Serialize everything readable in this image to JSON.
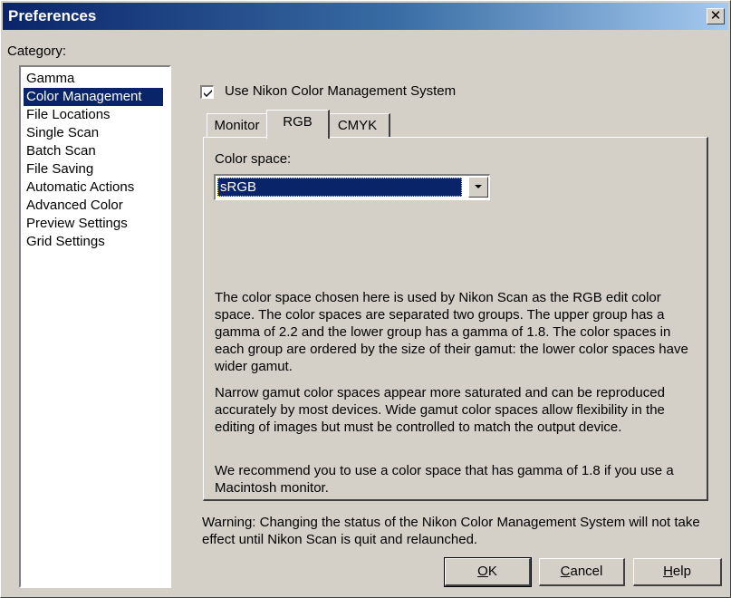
{
  "window": {
    "title": "Preferences",
    "close_glyph": "✕"
  },
  "category": {
    "label": "Category:",
    "items": [
      {
        "label": "Gamma"
      },
      {
        "label": "Color Management",
        "selected": true
      },
      {
        "label": "File Locations"
      },
      {
        "label": "Single Scan"
      },
      {
        "label": "Batch Scan"
      },
      {
        "label": "File Saving"
      },
      {
        "label": "Automatic Actions"
      },
      {
        "label": "Advanced Color"
      },
      {
        "label": "Preview Settings"
      },
      {
        "label": "Grid Settings"
      }
    ]
  },
  "cms": {
    "label": "Use Nikon Color Management System",
    "checked": true
  },
  "tabs": [
    {
      "label": "Monitor"
    },
    {
      "label": "RGB",
      "active": true
    },
    {
      "label": "CMYK"
    }
  ],
  "rgb": {
    "colorspace_label": "Color space:",
    "colorspace_value": "sRGB",
    "description": [
      "The color space chosen here is used by Nikon Scan as the RGB edit color space. The color spaces are separated two groups. The upper group has a gamma of 2.2 and the lower group has a gamma of 1.8. The color spaces in each group are ordered by the size of their gamut: the lower color spaces have wider gamut.",
      "Narrow gamut color spaces appear more saturated and can be reproduced accurately by most devices. Wide gamut color spaces allow flexibility in the editing of images but must be controlled to match the output device.",
      "We recommend you to use a color space that has gamma of 1.8 if you use a Macintosh monitor."
    ]
  },
  "warning": "Warning: Changing the status of the Nikon Color Management System will not take effect until Nikon Scan is quit and relaunched.",
  "buttons": {
    "ok": {
      "label": "OK",
      "mnemonic": "O",
      "rest": "K"
    },
    "cancel": {
      "label": "Cancel",
      "mnemonic": "C",
      "rest": "ancel"
    },
    "help": {
      "label": "Help",
      "mnemonic": "H",
      "rest": "elp"
    }
  }
}
